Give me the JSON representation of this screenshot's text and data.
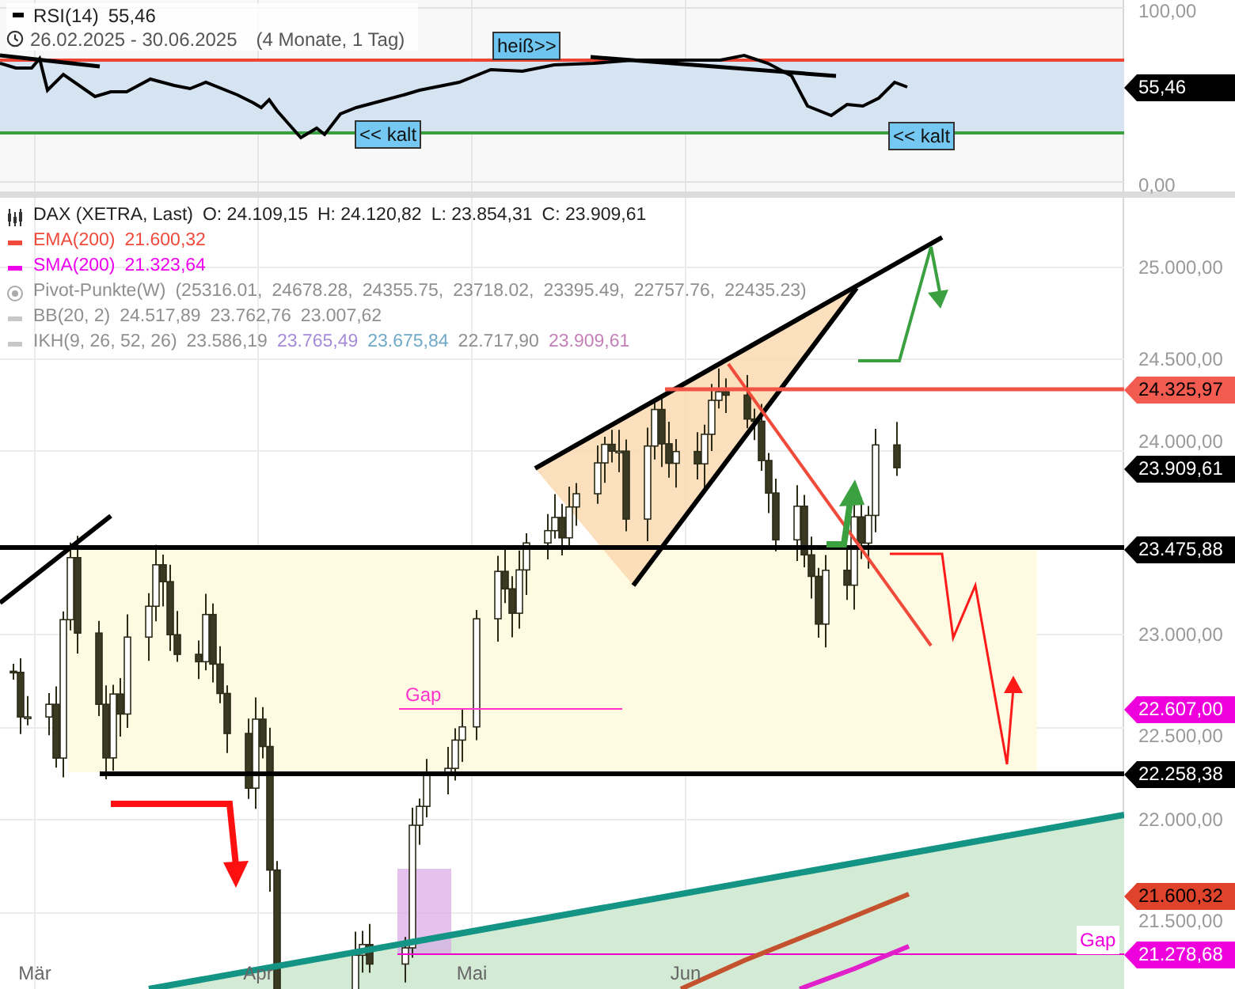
{
  "rsi_panel": {
    "legend": {
      "name": "RSI(14)",
      "value": "55,46"
    },
    "date_range": {
      "dates": "26.02.2025 - 30.06.2025",
      "period": "(4 Monate, 1 Tag)"
    },
    "zone_labels": [
      {
        "kind": "hot",
        "text": "heiß>>"
      },
      {
        "kind": "cold",
        "text": "<< kalt"
      },
      {
        "kind": "cold",
        "text": "<< kalt"
      }
    ],
    "axis_ticks": [
      "100,00",
      "0,00"
    ],
    "price_tags": [
      {
        "text": "55,46",
        "color": "#000000"
      }
    ]
  },
  "price_panel": {
    "legend": [
      {
        "kind": "candles",
        "name": "DAX (XETRA, Last)",
        "hidden": false,
        "values": [
          {
            "text": "O: 24.109,15"
          },
          {
            "text": "H: 24.120,82"
          },
          {
            "text": "L: 23.854,31"
          },
          {
            "text": "C: 23.909,61"
          }
        ]
      },
      {
        "kind": "line",
        "name": "EMA(200)",
        "color": "#f04a3c",
        "hidden": false,
        "values": [
          {
            "text": "21.600,32"
          }
        ]
      },
      {
        "kind": "line",
        "name": "SMA(200)",
        "color": "#ee00ee",
        "hidden": false,
        "values": [
          {
            "text": "21.323,64"
          }
        ]
      },
      {
        "kind": "pivot",
        "name": "Pivot-Punkte(W)",
        "hidden": true,
        "values": [
          {
            "text": "(25316.01,"
          },
          {
            "text": "24678.28,"
          },
          {
            "text": "24355.75,"
          },
          {
            "text": "23718.02,"
          },
          {
            "text": "23395.49,"
          },
          {
            "text": "22757.76,"
          },
          {
            "text": "22435.23)"
          }
        ]
      },
      {
        "kind": "line",
        "name": "BB(20, 2)",
        "hidden": true,
        "values": [
          {
            "text": "24.517,89"
          },
          {
            "text": "23.762,76"
          },
          {
            "text": "23.007,62"
          }
        ]
      },
      {
        "kind": "line",
        "name": "IKH(9, 26, 52, 26)",
        "hidden": true,
        "values": [
          {
            "text": "23.586,19"
          },
          {
            "text": "23.765,49",
            "color": "#a58ad8"
          },
          {
            "text": "23.675,84",
            "color": "#6fa9c8"
          },
          {
            "text": "22.717,90"
          },
          {
            "text": "23.909,61",
            "color": "#c47fb8"
          }
        ]
      }
    ],
    "gap_labels": [
      "Gap",
      "Gap"
    ],
    "axis_ticks": [
      "25.000,00",
      "24.500,00",
      "24.000,00",
      "23.000,00",
      "22.500,00",
      "22.000,00",
      "21.500,00"
    ],
    "price_tags": [
      {
        "text": "24.325,97",
        "color": "#f25c50"
      },
      {
        "text": "23.909,61",
        "color": "#000000"
      },
      {
        "text": "23.475,88",
        "color": "#000000"
      },
      {
        "text": "22.607,00",
        "color": "#ee00dd"
      },
      {
        "text": "22.258,38",
        "color": "#000000"
      },
      {
        "text": "21.600,32",
        "color": "#e0432c"
      },
      {
        "text": "21.278,68",
        "color": "#ee00dd"
      }
    ],
    "time_labels": [
      "Mär",
      "Apr",
      "Mai",
      "Jun"
    ]
  }
}
